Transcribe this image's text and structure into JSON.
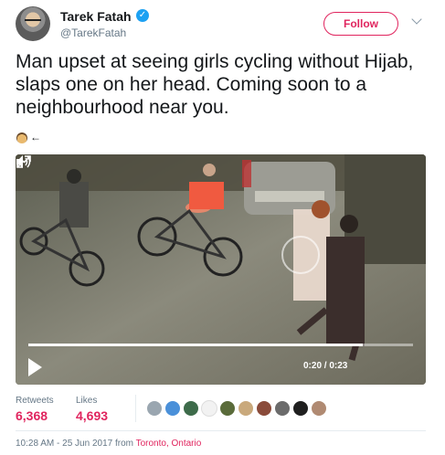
{
  "author": {
    "name": "Tarek Fatah",
    "handle": "@TarekFatah",
    "verified": true
  },
  "follow_label": "Follow",
  "tweet": {
    "text": "Man upset at seeing girls cycling without Hijab, slaps one on her head. Coming soon to a neighbourhood near you.",
    "emoji_line": "←"
  },
  "video": {
    "time": "0:20 / 0:23",
    "progress": 0.87
  },
  "stats": {
    "retweets_label": "Retweets",
    "retweets_value": "6,368",
    "likes_label": "Likes",
    "likes_value": "4,693"
  },
  "liker_avatars": 10,
  "meta": {
    "datetime": "10:28 AM - 25 Jun 2017 from",
    "city": "Toronto",
    "separator": ",",
    "region": "Ontario"
  },
  "colors": {
    "accent": "#e0245e",
    "verified": "#1da1f2",
    "muted": "#657786"
  }
}
